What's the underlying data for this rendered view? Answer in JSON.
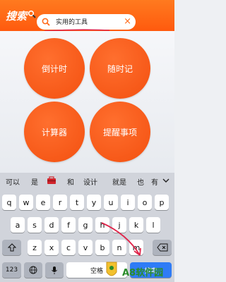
{
  "header": {
    "logo": "搜索",
    "search_text": "实用的工具",
    "clear_symbol": "×"
  },
  "tools": [
    {
      "label": "倒计时"
    },
    {
      "label": "随时记"
    },
    {
      "label": "计算器"
    },
    {
      "label": "提醒事项"
    }
  ],
  "keyboard": {
    "suggestions": [
      "可以",
      "是",
      "和",
      "设计",
      "就是",
      "也",
      "有"
    ],
    "row1": [
      "q",
      "w",
      "e",
      "r",
      "t",
      "y",
      "u",
      "i",
      "o",
      "p"
    ],
    "row2": [
      "a",
      "s",
      "d",
      "f",
      "g",
      "h",
      "j",
      "k",
      "l"
    ],
    "row3": [
      "z",
      "x",
      "c",
      "v",
      "b",
      "n",
      "m"
    ],
    "numbers_key": "123",
    "space_key": "空格",
    "search_key": "搜索"
  },
  "watermark": {
    "text": "A8软件园"
  },
  "colors": {
    "accent": "#ff5a0e",
    "search_key": "#2f7cf6",
    "annotation": "#e0254a"
  }
}
